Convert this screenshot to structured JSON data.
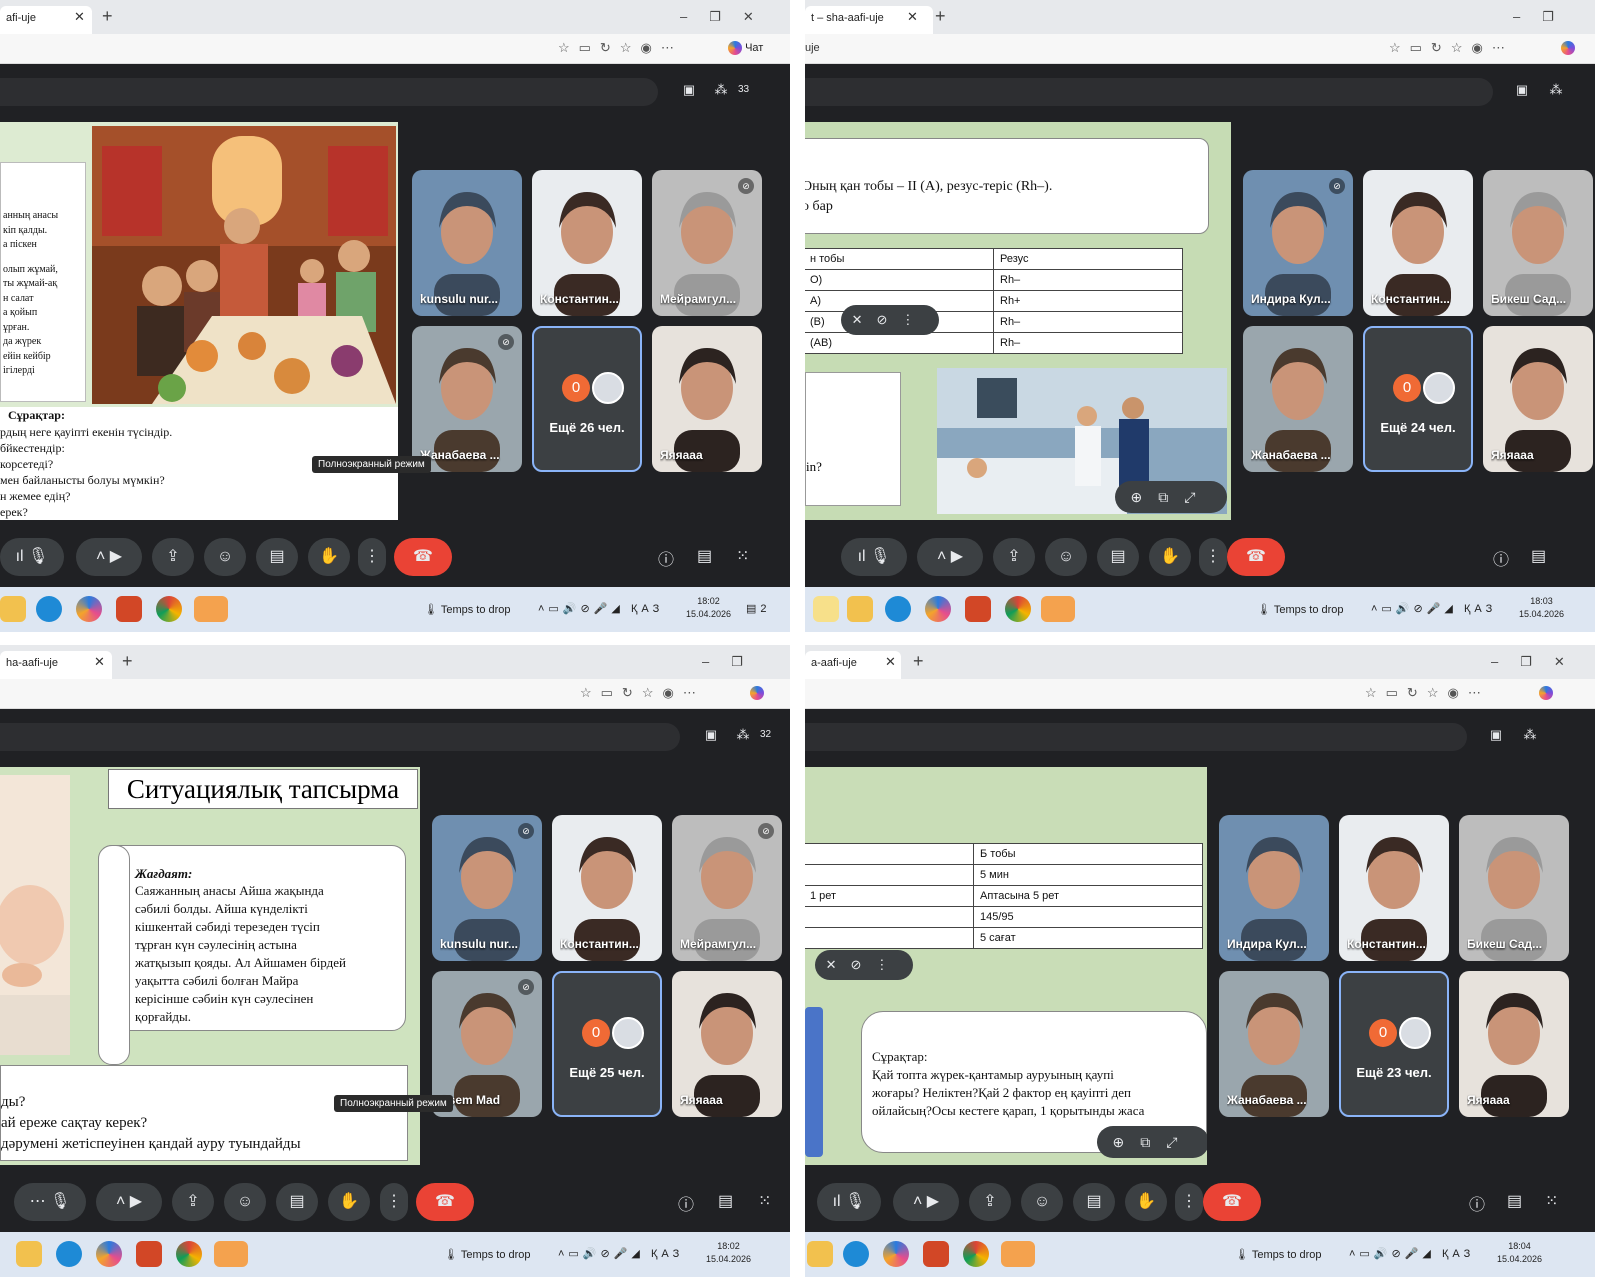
{
  "panels": [
    {
      "tab_title": "afi-uje",
      "url": "",
      "chat_label": "Чат",
      "participant_count": "33",
      "slide": {
        "text_lines": [
          "анның анасы",
          "кіп қалды.",
          "а піскен",
          "",
          "олып жұмай,",
          "ты жұмай-ақ",
          "н салат",
          "а қойып",
          "ұрған.",
          "да жүрек",
          "ейін кейбір",
          "ігілерді"
        ],
        "questions_title": "Сұрақтар:",
        "questions": [
          "рдың неге қауіпті екенін түсіндір.",
          "бйкестендір:",
          "корсетеді?",
          "мен байланысты болуы мүмкін?",
          "н жемее едің?",
          "ерек?"
        ]
      },
      "tiles": [
        {
          "name": "kunsulu nur...",
          "muted": false
        },
        {
          "name": "Константин...",
          "muted": false
        },
        {
          "name": "Мейрамгул...",
          "muted": true
        },
        {
          "name": "Жанабаева ...",
          "muted": true
        },
        {
          "name": "Ещё 26 чел.",
          "avatar": "0",
          "more": true
        },
        {
          "name": "Яяяааа",
          "muted": false
        }
      ],
      "tooltip": "Полноэкранный режим",
      "weather": "Temps to drop",
      "lang": "ҚАЗ",
      "time": "18:02",
      "date": "15.04.2026",
      "notif": "2"
    },
    {
      "tab_title": "t – sha-aafi-uje",
      "url": "uje",
      "slide": {
        "header_line1": "Оның қан тобы – II (A), резус-теріс (Rh–).",
        "header_line2": "о бар",
        "table_header": [
          "н тобы",
          "Резус"
        ],
        "table_rows": [
          [
            "O)",
            "Rh–"
          ],
          [
            "A)",
            "Rh+"
          ],
          [
            "(B)",
            "Rh–"
          ],
          [
            "(AB)",
            "Rh–"
          ]
        ],
        "side_text": "in?"
      },
      "tiles": [
        {
          "name": "Индира Кул...",
          "muted": true
        },
        {
          "name": "Константин...",
          "muted": false
        },
        {
          "name": "Бикеш Сад...",
          "muted": false
        },
        {
          "name": "Жанабаева ...",
          "muted": false
        },
        {
          "name": "Ещё 24 чел.",
          "avatar": "0",
          "more": true
        },
        {
          "name": "Яяяааа",
          "muted": false
        }
      ],
      "weather": "Temps to drop",
      "lang": "ҚАЗ",
      "time": "18:03",
      "date": "15.04.2026"
    },
    {
      "tab_title": "ha-aafi-uje",
      "url": "",
      "participant_count": "32",
      "slide": {
        "title": "Ситуациялық тапсырма",
        "scroll_title": "Жағдаят:",
        "scroll_lines": [
          "Саяжанның анасы Айша жақында",
          "сәбилі болды. Айша күнделікті",
          "кішкентай сәбиді терезеден түсіп",
          "тұрған күн сәулесінің астына",
          "жатқызып қояды. Ал Айшамен бірдей",
          "уақытта сәбилі болған Майра",
          "керісінше сәбиін күн сәулесінен",
          "қорғайды."
        ],
        "bottom_lines": [
          "ды?",
          "ай ереже сақтау керек?",
          "дәрумені жетіспеуінен қандай ауру туындайды"
        ]
      },
      "tiles": [
        {
          "name": "kunsulu nur...",
          "muted": true
        },
        {
          "name": "Константин...",
          "muted": false
        },
        {
          "name": "Мейрамгул...",
          "muted": true
        },
        {
          "name": "Asem Mad",
          "muted": true
        },
        {
          "name": "Ещё 25 чел.",
          "avatar": "0",
          "more": true
        },
        {
          "name": "Яяяааа",
          "muted": false
        }
      ],
      "tooltip": "Полноэкранный режим",
      "weather": "Temps to drop",
      "lang": "ҚАЗ",
      "time": "18:02",
      "date": "15.04.2026"
    },
    {
      "tab_title": "a-aafi-uje",
      "url": "",
      "slide": {
        "table_rows": [
          [
            "",
            "Б тобы"
          ],
          [
            "",
            "5 мин"
          ],
          [
            "1 рет",
            "Аптасына 5 рет"
          ],
          [
            "",
            "145/95"
          ],
          [
            "",
            "5 сағат"
          ]
        ],
        "q_title": "Сұрақтар:",
        "q_lines": [
          "Қай топта жүрек-қантамыр ауруының қаупі",
          "жоғары? Неліктен?Қай 2 фактор ең қауіпті деп",
          "ойлайсың?Осы кестеге қарап, 1 қорытынды жаса"
        ]
      },
      "tiles": [
        {
          "name": "Индира Кул...",
          "muted": false
        },
        {
          "name": "Константин...",
          "muted": false
        },
        {
          "name": "Бикеш Сад...",
          "muted": false
        },
        {
          "name": "Жанабаева ...",
          "muted": false
        },
        {
          "name": "Ещё 23 чел.",
          "avatar": "0",
          "more": true
        },
        {
          "name": "Яяяааа",
          "muted": false
        }
      ],
      "weather": "Temps to drop",
      "lang": "ҚАЗ",
      "time": "18:04",
      "date": "15.04.2026"
    }
  ]
}
